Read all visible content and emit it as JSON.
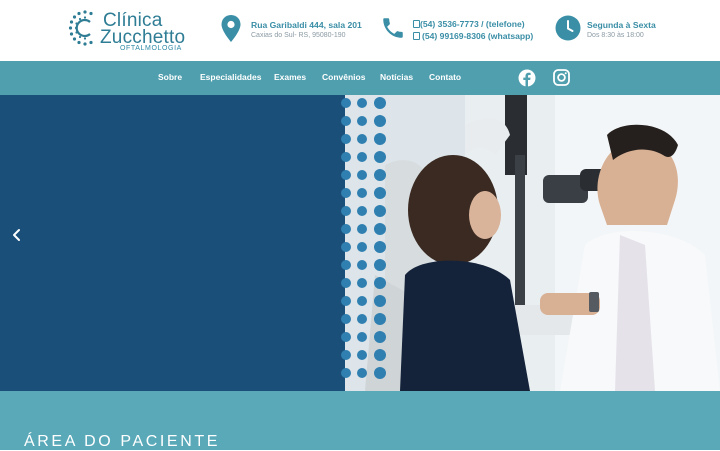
{
  "brand": {
    "name_line1": "Clínica",
    "name_line2": "Zucchetto",
    "subtitle": "OFTALMOLOGIA",
    "color": "#2f7d95"
  },
  "header": {
    "address": {
      "icon": "map-pin-icon",
      "line1": "Rua Garibaldi 444, sala 201",
      "line2": "Caxias do Sul- RS, 95080-190"
    },
    "phones": {
      "icon": "phone-icon",
      "line1": "(54) 3536-7773 / (telefone)",
      "line2": "(54) 99169-8306 (whatsapp)"
    },
    "hours": {
      "icon": "clock-icon",
      "line1": "Segunda à Sexta",
      "line2": "Dos 8:30 às 18:00"
    }
  },
  "nav": {
    "items": [
      "Sobre",
      "Especialidades",
      "Exames",
      "Convênios",
      "Notícias",
      "Contato"
    ],
    "social": [
      "facebook-icon",
      "instagram-icon"
    ],
    "background": "#4f9fae"
  },
  "hero": {
    "background": "#1a4f7a",
    "image": "doctor-eye-exam-photo",
    "prev_icon": "chevron-left-icon"
  },
  "section": {
    "title": "ÁREA DO PACIENTE",
    "background": "#5aa9b9"
  }
}
